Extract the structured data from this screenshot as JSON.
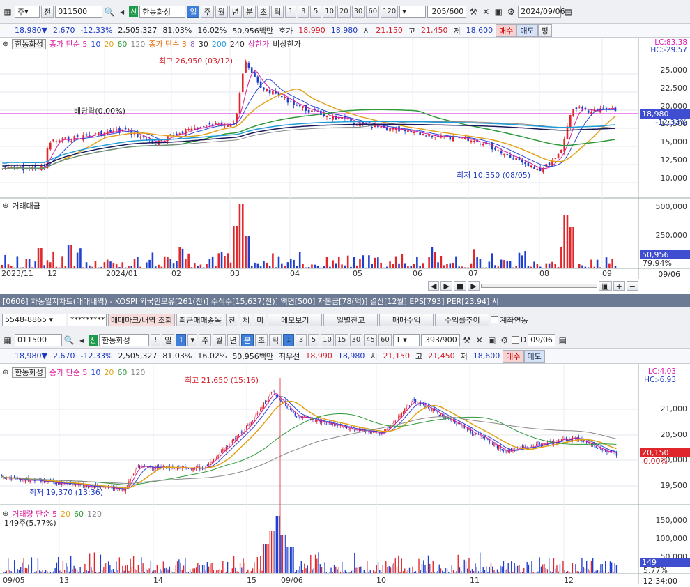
{
  "top": {
    "toolbar": {
      "market": "주",
      "market_btn": "전",
      "code": "011500",
      "stock_badge": "신",
      "stock_name": "한농화성",
      "periods": [
        "일",
        "주",
        "월",
        "년",
        "분",
        "초",
        "틱"
      ],
      "selected_period": "일",
      "intervals": [
        "1",
        "3",
        "5",
        "10",
        "20",
        "30",
        "60",
        "120"
      ],
      "count": "205",
      "count_total": "/600",
      "date": "2024/09/06"
    },
    "quote": {
      "price": "18,980▼",
      "change": "2,670",
      "change_pct": "-12.33%",
      "volume": "2,505,327",
      "rate1": "81.03%",
      "rate2": "16.02%",
      "amount": "50,956백만",
      "ask_label": "호가",
      "ask": "18,990",
      "bid": "18,980",
      "open_label": "시",
      "open": "21,150",
      "high_label": "고",
      "high": "21,450",
      "low_label": "저",
      "low": "18,600",
      "buy": "매수",
      "sell": "매도",
      "eval": "평"
    },
    "legend": {
      "name": "한농화성",
      "ma1_label": "종가 단순 5",
      "ma1_vals": [
        "10",
        "20",
        "60",
        "120"
      ],
      "ma2_label": "종가 단순 3",
      "ma2_vals": [
        "8",
        "30",
        "200",
        "240"
      ],
      "upper": "상한가",
      "nonupper": "비상한가"
    },
    "axis": {
      "lc": "LC:83.38",
      "hc": "HC:-29.57",
      "ticks": [
        "25,000",
        "22,500",
        "20,000",
        "17,500",
        "15,000",
        "12,500",
        "10,000"
      ],
      "price_tag": "18,980",
      "pct_tag": "-12.33%"
    },
    "annot": {
      "high": "최고 26,950 (03/12)",
      "low": "최저 10,350 (08/05)",
      "dividend": "배당락(0.00%)"
    },
    "vol": {
      "title": "거래대금",
      "ticks": [
        "500,000",
        "250,000"
      ],
      "tag": "50,956",
      "pct": "79.94%"
    },
    "xaxis": [
      "2023/11",
      "12",
      "2024/01",
      "02",
      "03",
      "04",
      "05",
      "06",
      "07",
      "08",
      "09",
      "09/06"
    ]
  },
  "divider": "[0606] 차동일지차트(매매내역) - KOSPI 외국인모유[261(전)] 수식수[15,637(전)] 액면[500] 자본금[78(억)] 결산[12월] EPS[793] PER[23.94] 시",
  "bottom": {
    "toolbar1": {
      "account": "5548-8865",
      "password": "*********",
      "btn1": "매매마크/내역 조회",
      "btn2": "최근매매종목",
      "btn3": "잔",
      "btn4": "체",
      "btn5": "미",
      "btn6": "메모보기",
      "btn7": "일별잔고",
      "btn8": "매매수익",
      "btn9": "수익률추이",
      "check": "계좌연동"
    },
    "toolbar2": {
      "code": "011500",
      "stock_badge": "신",
      "stock_name": "한농화성",
      "excl": "!",
      "period": "일",
      "period_num": "1",
      "periods": [
        "주",
        "월",
        "년",
        "분",
        "초",
        "틱"
      ],
      "selected": "분",
      "intervals": [
        "1",
        "3",
        "5",
        "10",
        "15",
        "30",
        "45",
        "60"
      ],
      "custom": "1",
      "count": "393",
      "count_total": "/900",
      "date_label": "D",
      "date": "09/06"
    },
    "quote": {
      "price": "18,980▼",
      "change": "2,670",
      "change_pct": "-12.33%",
      "volume": "2,505,327",
      "rate1": "81.03%",
      "rate2": "16.02%",
      "amount": "50,956백만",
      "best_label": "최우선",
      "ask": "18,990",
      "bid": "18,980",
      "open_label": "시",
      "open": "21,150",
      "high_label": "고",
      "high": "21,450",
      "low_label": "저",
      "low": "18,600",
      "buy": "매수",
      "sell": "매도"
    },
    "legend": {
      "name": "한농화성",
      "ma_label": "종가 단순 5",
      "ma_vals": [
        "10",
        "20",
        "60",
        "120"
      ]
    },
    "axis": {
      "lc": "LC:4.03",
      "hc": "HC:-6.93",
      "ticks": [
        "21,000",
        "20,500",
        "20,000",
        "19,500"
      ],
      "price_tag": "20,150",
      "pct_tag": "0.00%"
    },
    "annot": {
      "high": "최고 21,650 (15:16)",
      "low": "최저 19,370 (13:36)"
    },
    "vol": {
      "title": "거래량 단순 5",
      "ma_vals": [
        "20",
        "60",
        "120"
      ],
      "sub": "149주(5.77%)",
      "ticks": [
        "150,000",
        "100,000",
        "50,000"
      ],
      "tag": "149",
      "pct": "5.77%"
    },
    "xaxis": [
      "09/05",
      "13",
      "14",
      "15",
      "09/06",
      "10",
      "11",
      "12",
      "12:34:00"
    ]
  },
  "colors": {
    "up": "#e0262b",
    "down": "#1f3fcf",
    "ma5": "#d81b9a",
    "ma10": "#2b46d6",
    "ma20": "#e2a21a",
    "ma60": "#2e9a3a",
    "ma120": "#888888"
  }
}
